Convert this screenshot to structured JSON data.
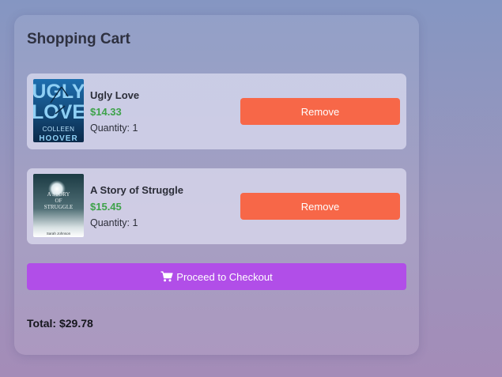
{
  "cart": {
    "title": "Shopping Cart",
    "items": [
      {
        "name": "Ugly Love",
        "price": "$14.33",
        "quantity": "Quantity: 1",
        "remove_label": "Remove",
        "cover": {
          "line1": "UGLY",
          "line2": "LOVE",
          "author_first": "COLLEEN",
          "author_last": "HOOVER"
        }
      },
      {
        "name": "A Story of Struggle",
        "price": "$15.45",
        "quantity": "Quantity: 1",
        "remove_label": "Remove",
        "cover": {
          "line1": "A STORY",
          "line2": "OF",
          "line3": "STRUGGLE",
          "author": "Sarah Johnson"
        }
      }
    ],
    "checkout_label": "Proceed to Checkout",
    "total": "Total: $29.78"
  },
  "colors": {
    "price": "#3ea24a",
    "remove_button": "#f76748",
    "checkout_button": "#b14ee8"
  },
  "icons": {
    "checkout": "shopping-cart-icon"
  }
}
